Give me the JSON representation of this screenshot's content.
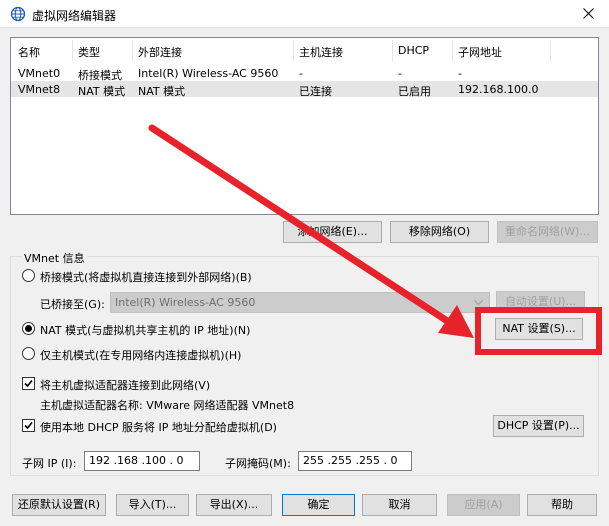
{
  "window": {
    "title": "虚拟网络编辑器"
  },
  "network_list": {
    "columns": [
      "名称",
      "类型",
      "外部连接",
      "主机连接",
      "DHCP",
      "子网地址"
    ],
    "rows": [
      {
        "name": "VMnet0",
        "type": "桥接模式",
        "external": "Intel(R) Wireless-AC 9560",
        "host": "-",
        "dhcp": "-",
        "subnet": "-"
      },
      {
        "name": "VMnet8",
        "type": "NAT 模式",
        "external": "NAT 模式",
        "host": "已连接",
        "dhcp": "已启用",
        "subnet": "192.168.100.0"
      }
    ]
  },
  "list_buttons": {
    "add": "添加网络(E)...",
    "remove": "移除网络(O)",
    "rename": "重命名网络(W)..."
  },
  "vmnet_info": {
    "title": "VMnet 信息",
    "bridge_mode": "桥接模式(将虚拟机直接连接到外部网络)(B)",
    "bridged_to_label": "已桥接至(G):",
    "bridged_to_value": "Intel(R) Wireless-AC 9560",
    "auto_settings": "自动设置(U)...",
    "nat_mode": "NAT 模式(与虚拟机共享主机的 IP 地址)(N)",
    "nat_settings": "NAT 设置(S)...",
    "host_only": "仅主机模式(在专用网络内连接虚拟机)(H)",
    "connect_adapter": "将主机虚拟适配器连接到此网络(V)",
    "adapter_name": "主机虚拟适配器名称: VMware 网络适配器 VMnet8",
    "use_dhcp": "使用本地 DHCP 服务将 IP 地址分配给虚拟机(D)",
    "dhcp_settings": "DHCP 设置(P)...",
    "subnet_ip_label": "子网 IP (I):",
    "subnet_ip_value": "192 .168 .100 . 0",
    "subnet_mask_label": "子网掩码(M):",
    "subnet_mask_value": "255 .255 .255 . 0",
    "selected_mode": "nat",
    "connect_adapter_checked": true,
    "use_dhcp_checked": true
  },
  "footer": {
    "restore": "还原默认设置(R)",
    "import": "导入(T)...",
    "export": "导出(X)...",
    "ok": "确定",
    "cancel": "取消",
    "apply": "应用(A)",
    "help": "帮助"
  },
  "annotation": {
    "color": "#e8222a"
  }
}
